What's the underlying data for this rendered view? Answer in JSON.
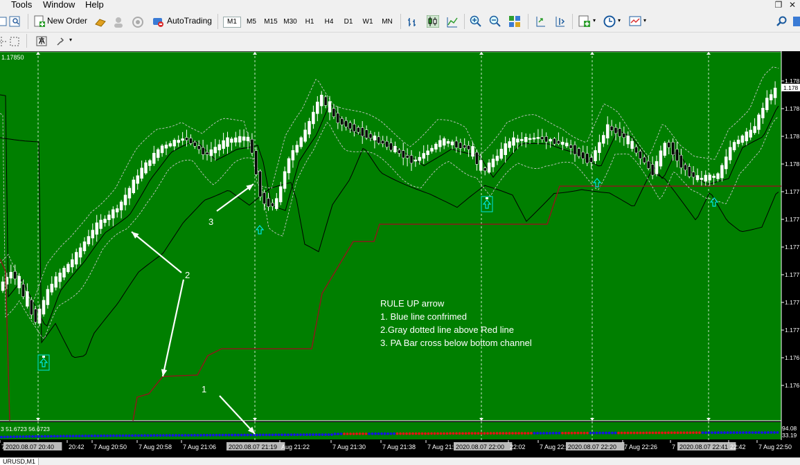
{
  "menu": {
    "items": [
      "Tools",
      "Window",
      "Help"
    ]
  },
  "toolbar": {
    "new_order_label": "New Order",
    "autotrading_label": "AutoTrading",
    "timeframes": [
      "M1",
      "M5",
      "M15",
      "M30",
      "H1",
      "H4",
      "D1",
      "W1",
      "MN"
    ],
    "active_timeframe": "M1",
    "text_tool_label": "A"
  },
  "chart": {
    "top_price_label": "1.17850",
    "price_axis_labels": [
      "1.178",
      "1.178",
      "1.178",
      "1.178",
      "1.177",
      "1.177",
      "1.177",
      "1.177",
      "1.177",
      "1.177",
      "1.176",
      "1.176"
    ],
    "price_axis_partial": "1.178",
    "indicator_readout": "3 51.6723 56.6723",
    "indicator_axis_labels": [
      "94.08",
      "33.19"
    ],
    "time_labels": [
      {
        "text": "7",
        "highlight": false
      },
      {
        "text": "2020.08.07 20:40",
        "highlight": true
      },
      {
        "text": "20:42",
        "highlight": false
      },
      {
        "text": "7 Aug 20:50",
        "highlight": false
      },
      {
        "text": "7 Aug 20:58",
        "highlight": false
      },
      {
        "text": "7 Aug 21:06",
        "highlight": false
      },
      {
        "text": "2020.08.07 21:19",
        "highlight": true
      },
      {
        "text": "Aug 21:22",
        "highlight": false
      },
      {
        "text": "7 Aug 21:30",
        "highlight": false
      },
      {
        "text": "7 Aug 21:38",
        "highlight": false
      },
      {
        "text": "7 Aug 21:46",
        "highlight": false
      },
      {
        "text": "2020.08.07 22:00",
        "highlight": true
      },
      {
        "text": "22:02",
        "highlight": false
      },
      {
        "text": "7 Aug 22:",
        "highlight": false
      },
      {
        "text": "2020.08.07 22:20",
        "highlight": true
      },
      {
        "text": "7 Aug 22:26",
        "highlight": false
      },
      {
        "text": "7",
        "highlight": false
      },
      {
        "text": "2020.08.07 22:41",
        "highlight": true
      },
      {
        "text": "22:42",
        "highlight": false
      },
      {
        "text": "7 Aug 22:50",
        "highlight": false
      }
    ],
    "annotations": {
      "rule_title": "RULE UP arrow",
      "rule_1": "1. Blue line confrimed",
      "rule_2": "2.Gray dotted line above Red line",
      "rule_3": "3. PA Bar cross below bottom channel",
      "marker_1": "1",
      "marker_2": "2",
      "marker_3": "3"
    },
    "colors": {
      "background": "#007f00",
      "candle_up": "#ffffff",
      "candle_down": "#000000",
      "channel": "#000000",
      "band_dotted": "#c8c8c8",
      "stop_line": "#8b1a1a",
      "signal_arrow": "#00e5e5",
      "blue_dots": "#1414e6",
      "red_dots": "#e61414"
    }
  },
  "statusbar": {
    "symbol_tab": "URUSD,M1"
  }
}
